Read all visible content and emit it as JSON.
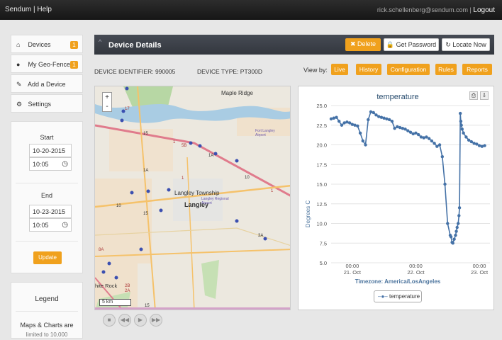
{
  "topbar": {
    "brand": "Sendum | Help",
    "email": "rick.schellenberg@sendum.com",
    "separator": "|",
    "logout": "Logout"
  },
  "sidebar": {
    "items": [
      {
        "label": "Devices",
        "icon": "home-icon",
        "badge": "1"
      },
      {
        "label": "My Geo-Fences",
        "icon": "map-marker-icon",
        "badge": "1"
      },
      {
        "label": "Add a Device",
        "icon": "pencil-icon"
      },
      {
        "label": "Settings",
        "icon": "gear-icon"
      }
    ]
  },
  "daterange": {
    "start_label": "Start",
    "start_date": "10-20-2015",
    "start_time": "10:05",
    "end_label": "End",
    "end_date": "10-23-2015",
    "end_time": "10:05",
    "update": "Update"
  },
  "legend": {
    "title": "Legend",
    "line1": "Maps & Charts are",
    "line2": "limited to 10,000"
  },
  "header": {
    "title": "Device Details",
    "delete": "Delete",
    "get_password": "Get Password",
    "locate_now": "Locate Now"
  },
  "device": {
    "identifier": "DEVICE IDENTIFIER: 990005",
    "type": "DEVICE TYPE: PT300D"
  },
  "viewby": {
    "label": "View by:",
    "buttons": [
      "Live",
      "History",
      "Configuration",
      "Rules",
      "Reports"
    ]
  },
  "map": {
    "zoom_in": "+",
    "zoom_out": "-",
    "places": [
      "Maple Ridge",
      "Langley Township",
      "Langley",
      "Langley Regional Airport",
      "Fort Langley Airport",
      "hite Rock"
    ],
    "scale": "5 km",
    "routes": [
      "17",
      "15",
      "1",
      "1A",
      "10",
      "5B",
      "1",
      "1A",
      "15",
      "10",
      "1",
      "3A",
      "8A",
      "2B",
      "2A",
      "15"
    ]
  },
  "chart_data": {
    "type": "line",
    "title": "temperature",
    "xlabel": "Timezone: America/LosAngeles",
    "ylabel": "Degrees C",
    "ylim": [
      5.0,
      25.0
    ],
    "yticks": [
      "25.0",
      "22.5",
      "20.0",
      "17.5",
      "15.0",
      "12.5",
      "10.0",
      "7.5",
      "5.0"
    ],
    "xticks": [
      {
        "t": 8.0,
        "line1": "00:00",
        "line2": "21. Oct"
      },
      {
        "t": 32.0,
        "line1": "00:00",
        "line2": "22. Oct"
      },
      {
        "t": 56.0,
        "line1": "00:00",
        "line2": "23. Oct"
      }
    ],
    "series": [
      {
        "name": "temperature",
        "x": [
          0,
          1,
          2,
          3,
          4,
          5,
          6,
          7,
          8,
          9,
          10,
          11,
          12,
          13,
          14,
          15,
          16,
          17,
          18,
          19,
          20,
          21,
          22,
          23,
          24,
          25,
          26,
          27,
          28,
          29,
          30,
          31,
          32,
          33,
          34,
          35,
          36,
          37,
          38,
          39,
          40,
          41,
          42,
          43,
          44,
          45,
          45.3,
          45.7,
          46,
          46.5,
          47,
          47.3,
          47.6,
          48,
          48.3,
          48.5,
          48.8,
          49,
          49.2,
          49.5,
          50,
          51,
          52,
          53,
          54,
          55,
          56,
          57,
          58
        ],
        "y": [
          23.3,
          23.4,
          23.5,
          23.0,
          22.5,
          22.8,
          22.9,
          22.8,
          22.6,
          22.5,
          22.4,
          21.5,
          20.5,
          20.0,
          23.2,
          24.2,
          24.1,
          23.8,
          23.6,
          23.5,
          23.4,
          23.3,
          23.2,
          23.0,
          22.1,
          22.3,
          22.2,
          22.1,
          22.0,
          21.8,
          21.6,
          21.4,
          21.5,
          21.3,
          21.0,
          20.9,
          21.0,
          20.8,
          20.5,
          20.2,
          19.8,
          20.0,
          18.5,
          15.0,
          10.0,
          8.5,
          8.3,
          7.6,
          7.5,
          8.0,
          8.5,
          9.0,
          9.5,
          10.0,
          11.0,
          12.0,
          24.0,
          23.0,
          22.5,
          22.0,
          21.5,
          21.0,
          20.6,
          20.4,
          20.2,
          20.1,
          19.9,
          19.8,
          19.9
        ]
      }
    ],
    "xlim": [
      0,
      60
    ],
    "legend_placement": "bottom-center",
    "color": "#4572a7"
  }
}
